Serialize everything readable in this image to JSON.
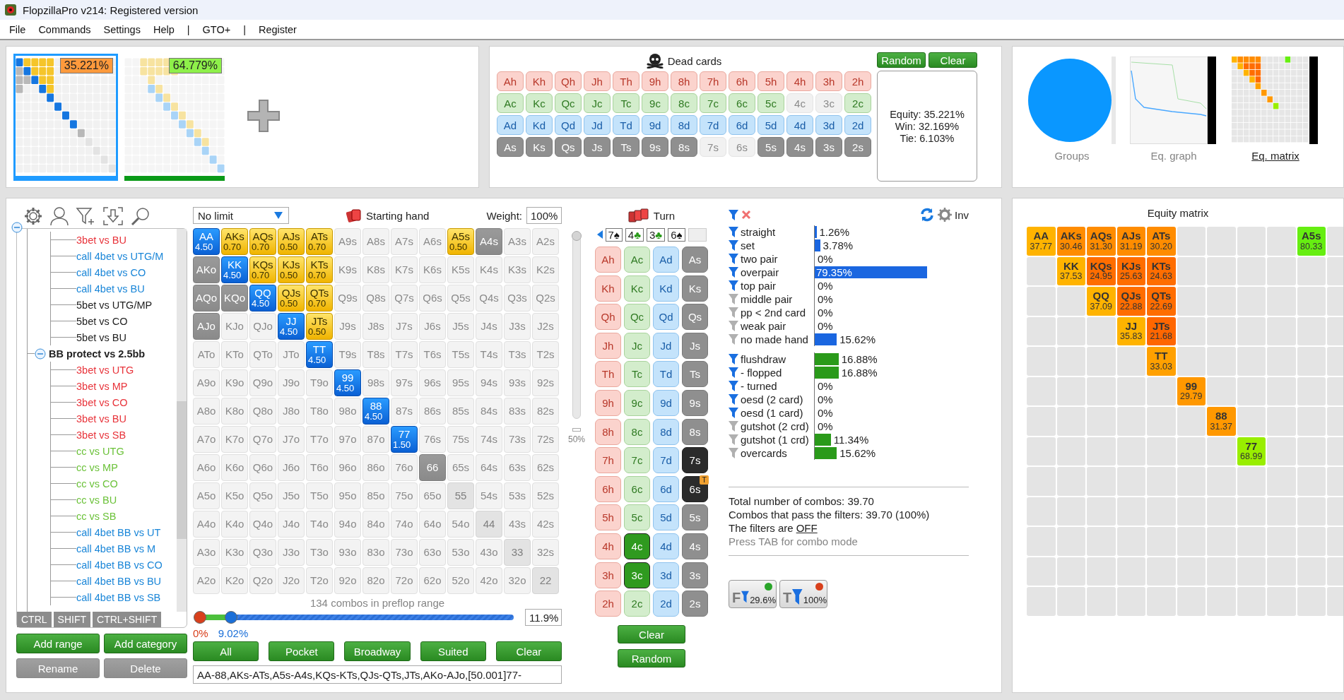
{
  "window": {
    "title": "FlopzillaPro v214: Registered version"
  },
  "menu": [
    "File",
    "Commands",
    "Settings",
    "Help",
    "|",
    "GTO+",
    "|",
    "Register"
  ],
  "ranges": [
    {
      "equity": "35.221%",
      "selected": true,
      "color": "#ff9a3c"
    },
    {
      "equity": "64.779%",
      "selected": false,
      "color": "#8ef04a"
    }
  ],
  "dead_cards": {
    "title": "Dead cards",
    "buttons": [
      "Random",
      "Clear"
    ],
    "rows": [
      {
        "kind": "hearts",
        "cards": [
          {
            "card": "Ah",
            "available": true
          },
          {
            "card": "Kh",
            "available": true
          },
          {
            "card": "Qh",
            "available": true
          },
          {
            "card": "Jh",
            "available": true
          },
          {
            "card": "Th",
            "available": true
          },
          {
            "card": "9h",
            "available": true
          },
          {
            "card": "8h",
            "available": true
          },
          {
            "card": "7h",
            "available": true
          },
          {
            "card": "6h",
            "available": true
          },
          {
            "card": "5h",
            "available": true
          },
          {
            "card": "4h",
            "available": true
          },
          {
            "card": "3h",
            "available": true
          },
          {
            "card": "2h",
            "available": true
          }
        ]
      },
      {
        "kind": "clubs",
        "cards": [
          {
            "card": "Ac",
            "available": true
          },
          {
            "card": "Kc",
            "available": true
          },
          {
            "card": "Qc",
            "available": true
          },
          {
            "card": "Jc",
            "available": true
          },
          {
            "card": "Tc",
            "available": true
          },
          {
            "card": "9c",
            "available": true
          },
          {
            "card": "8c",
            "available": true
          },
          {
            "card": "7c",
            "available": true
          },
          {
            "card": "6c",
            "available": true
          },
          {
            "card": "5c",
            "available": true
          },
          {
            "card": "4c",
            "available": false
          },
          {
            "card": "3c",
            "available": false
          },
          {
            "card": "2c",
            "available": true
          }
        ]
      },
      {
        "kind": "diamonds",
        "cards": [
          {
            "card": "Ad",
            "available": true
          },
          {
            "card": "Kd",
            "available": true
          },
          {
            "card": "Qd",
            "available": true
          },
          {
            "card": "Jd",
            "available": true
          },
          {
            "card": "Td",
            "available": true
          },
          {
            "card": "9d",
            "available": true
          },
          {
            "card": "8d",
            "available": true
          },
          {
            "card": "7d",
            "available": true
          },
          {
            "card": "6d",
            "available": true
          },
          {
            "card": "5d",
            "available": true
          },
          {
            "card": "4d",
            "available": true
          },
          {
            "card": "3d",
            "available": true
          },
          {
            "card": "2d",
            "available": true
          }
        ]
      },
      {
        "kind": "spades",
        "cards": [
          {
            "card": "As",
            "available": true
          },
          {
            "card": "Ks",
            "available": true
          },
          {
            "card": "Qs",
            "available": true
          },
          {
            "card": "Js",
            "available": true
          },
          {
            "card": "Ts",
            "available": true
          },
          {
            "card": "9s",
            "available": true
          },
          {
            "card": "8s",
            "available": true
          },
          {
            "card": "7s",
            "available": false
          },
          {
            "card": "6s",
            "available": false
          },
          {
            "card": "5s",
            "available": true
          },
          {
            "card": "4s",
            "available": true
          },
          {
            "card": "3s",
            "available": true
          },
          {
            "card": "2s",
            "available": true
          }
        ]
      }
    ],
    "results": [
      "Equity: 35.221%",
      "Win: 32.169%",
      "Tie: 6.103%"
    ]
  },
  "views": [
    {
      "label": "Groups",
      "kind": "pie",
      "selected": false
    },
    {
      "label": "Eq. graph",
      "kind": "graph",
      "selected": false
    },
    {
      "label": "Eq. matrix",
      "kind": "matrix",
      "selected": true
    }
  ],
  "tree": {
    "expanded": true,
    "groups": [
      {
        "children": [
          {
            "label": "3bet vs BU",
            "color": "#e8333a"
          },
          {
            "label": "call 4bet vs UTG/M",
            "color": "#1a86d8"
          },
          {
            "label": "call 4bet vs CO",
            "color": "#1a86d8"
          },
          {
            "label": "call 4bet vs BU",
            "color": "#1a86d8"
          },
          {
            "label": "5bet vs UTG/MP",
            "color": "#222222"
          },
          {
            "label": "5bet vs CO",
            "color": "#222222"
          },
          {
            "label": "5bet vs BU",
            "color": "#222222"
          }
        ]
      },
      {
        "label": "BB protect vs 2.5bb",
        "expanded": true,
        "children": [
          {
            "label": "3bet vs UTG",
            "color": "#e8333a"
          },
          {
            "label": "3bet vs MP",
            "color": "#e8333a"
          },
          {
            "label": "3bet vs CO",
            "color": "#e8333a"
          },
          {
            "label": "3bet vs BU",
            "color": "#e8333a"
          },
          {
            "label": "3bet vs SB",
            "color": "#e8333a"
          },
          {
            "label": "cc vs UTG",
            "color": "#6cc23a"
          },
          {
            "label": "cc vs MP",
            "color": "#6cc23a"
          },
          {
            "label": "cc vs CO",
            "color": "#6cc23a"
          },
          {
            "label": "cc vs BU",
            "color": "#6cc23a"
          },
          {
            "label": "cc vs SB",
            "color": "#6cc23a"
          },
          {
            "label": "call 4bet BB vs UT",
            "color": "#1a86d8"
          },
          {
            "label": "call 4bet BB vs M",
            "color": "#1a86d8"
          },
          {
            "label": "call 4bet BB vs CO",
            "color": "#1a86d8"
          },
          {
            "label": "call 4bet BB vs BU",
            "color": "#1a86d8"
          },
          {
            "label": "call 4bet BB vs SB",
            "color": "#1a86d8"
          }
        ]
      }
    ]
  },
  "modifier_keys": [
    "CTRL",
    "SHIFT",
    "CTRL+SHIFT"
  ],
  "tree_buttons": [
    {
      "label": "Add range",
      "disabled": false
    },
    {
      "label": "Add category",
      "disabled": false
    },
    {
      "label": "Rename",
      "disabled": true
    },
    {
      "label": "Delete",
      "disabled": true
    }
  ],
  "game": "No limit",
  "hand_title": "Starting hand",
  "weight_label": "Weight:",
  "weight": "100%",
  "weight_slider": {
    "level": 1,
    "tick": "50%"
  },
  "hand_matrix": [
    [
      {
        "hand": "AA",
        "kind": "pair",
        "weight": "4.50"
      },
      {
        "hand": "AKs",
        "kind": "suited",
        "weight": "0.70"
      },
      {
        "hand": "AQs",
        "kind": "suited",
        "weight": "0.70"
      },
      {
        "hand": "AJs",
        "kind": "suited",
        "weight": "0.50"
      },
      {
        "hand": "ATs",
        "kind": "suited",
        "weight": "0.70"
      },
      {
        "hand": "A9s",
        "kind": "none"
      },
      {
        "hand": "A8s",
        "kind": "none"
      },
      {
        "hand": "A7s",
        "kind": "none"
      },
      {
        "hand": "A6s",
        "kind": "none"
      },
      {
        "hand": "A5s",
        "kind": "suited",
        "weight": "0.50"
      },
      {
        "hand": "A4s",
        "kind": "partial"
      },
      {
        "hand": "A3s",
        "kind": "none"
      },
      {
        "hand": "A2s",
        "kind": "none"
      }
    ],
    [
      {
        "hand": "AKo",
        "kind": "partial"
      },
      {
        "hand": "KK",
        "kind": "pair",
        "weight": "4.50"
      },
      {
        "hand": "KQs",
        "kind": "suited",
        "weight": "0.70"
      },
      {
        "hand": "KJs",
        "kind": "suited",
        "weight": "0.50"
      },
      {
        "hand": "KTs",
        "kind": "suited",
        "weight": "0.70"
      },
      {
        "hand": "K9s",
        "kind": "none"
      },
      {
        "hand": "K8s",
        "kind": "none"
      },
      {
        "hand": "K7s",
        "kind": "none"
      },
      {
        "hand": "K6s",
        "kind": "none"
      },
      {
        "hand": "K5s",
        "kind": "none"
      },
      {
        "hand": "K4s",
        "kind": "none"
      },
      {
        "hand": "K3s",
        "kind": "none"
      },
      {
        "hand": "K2s",
        "kind": "none"
      }
    ],
    [
      {
        "hand": "AQo",
        "kind": "partial"
      },
      {
        "hand": "KQo",
        "kind": "partial"
      },
      {
        "hand": "QQ",
        "kind": "pair",
        "weight": "4.50"
      },
      {
        "hand": "QJs",
        "kind": "suited",
        "weight": "0.50"
      },
      {
        "hand": "QTs",
        "kind": "suited",
        "weight": "0.70"
      },
      {
        "hand": "Q9s",
        "kind": "none"
      },
      {
        "hand": "Q8s",
        "kind": "none"
      },
      {
        "hand": "Q7s",
        "kind": "none"
      },
      {
        "hand": "Q6s",
        "kind": "none"
      },
      {
        "hand": "Q5s",
        "kind": "none"
      },
      {
        "hand": "Q4s",
        "kind": "none"
      },
      {
        "hand": "Q3s",
        "kind": "none"
      },
      {
        "hand": "Q2s",
        "kind": "none"
      }
    ],
    [
      {
        "hand": "AJo",
        "kind": "partial"
      },
      {
        "hand": "KJo",
        "kind": "none"
      },
      {
        "hand": "QJo",
        "kind": "none"
      },
      {
        "hand": "JJ",
        "kind": "pair",
        "weight": "4.50"
      },
      {
        "hand": "JTs",
        "kind": "suited",
        "weight": "0.50"
      },
      {
        "hand": "J9s",
        "kind": "none"
      },
      {
        "hand": "J8s",
        "kind": "none"
      },
      {
        "hand": "J7s",
        "kind": "none"
      },
      {
        "hand": "J6s",
        "kind": "none"
      },
      {
        "hand": "J5s",
        "kind": "none"
      },
      {
        "hand": "J4s",
        "kind": "none"
      },
      {
        "hand": "J3s",
        "kind": "none"
      },
      {
        "hand": "J2s",
        "kind": "none"
      }
    ],
    [
      {
        "hand": "ATo",
        "kind": "none"
      },
      {
        "hand": "KTo",
        "kind": "none"
      },
      {
        "hand": "QTo",
        "kind": "none"
      },
      {
        "hand": "JTo",
        "kind": "none"
      },
      {
        "hand": "TT",
        "kind": "pair",
        "weight": "4.50"
      },
      {
        "hand": "T9s",
        "kind": "none"
      },
      {
        "hand": "T8s",
        "kind": "none"
      },
      {
        "hand": "T7s",
        "kind": "none"
      },
      {
        "hand": "T6s",
        "kind": "none"
      },
      {
        "hand": "T5s",
        "kind": "none"
      },
      {
        "hand": "T4s",
        "kind": "none"
      },
      {
        "hand": "T3s",
        "kind": "none"
      },
      {
        "hand": "T2s",
        "kind": "none"
      }
    ],
    [
      {
        "hand": "A9o",
        "kind": "none"
      },
      {
        "hand": "K9o",
        "kind": "none"
      },
      {
        "hand": "Q9o",
        "kind": "none"
      },
      {
        "hand": "J9o",
        "kind": "none"
      },
      {
        "hand": "T9o",
        "kind": "none"
      },
      {
        "hand": "99",
        "kind": "pair",
        "weight": "4.50"
      },
      {
        "hand": "98s",
        "kind": "none"
      },
      {
        "hand": "97s",
        "kind": "none"
      },
      {
        "hand": "96s",
        "kind": "none"
      },
      {
        "hand": "95s",
        "kind": "none"
      },
      {
        "hand": "94s",
        "kind": "none"
      },
      {
        "hand": "93s",
        "kind": "none"
      },
      {
        "hand": "92s",
        "kind": "none"
      }
    ],
    [
      {
        "hand": "A8o",
        "kind": "none"
      },
      {
        "hand": "K8o",
        "kind": "none"
      },
      {
        "hand": "Q8o",
        "kind": "none"
      },
      {
        "hand": "J8o",
        "kind": "none"
      },
      {
        "hand": "T8o",
        "kind": "none"
      },
      {
        "hand": "98o",
        "kind": "none"
      },
      {
        "hand": "88",
        "kind": "pair",
        "weight": "4.50"
      },
      {
        "hand": "87s",
        "kind": "none"
      },
      {
        "hand": "86s",
        "kind": "none"
      },
      {
        "hand": "85s",
        "kind": "none"
      },
      {
        "hand": "84s",
        "kind": "none"
      },
      {
        "hand": "83s",
        "kind": "none"
      },
      {
        "hand": "82s",
        "kind": "none"
      }
    ],
    [
      {
        "hand": "A7o",
        "kind": "none"
      },
      {
        "hand": "K7o",
        "kind": "none"
      },
      {
        "hand": "Q7o",
        "kind": "none"
      },
      {
        "hand": "J7o",
        "kind": "none"
      },
      {
        "hand": "T7o",
        "kind": "none"
      },
      {
        "hand": "97o",
        "kind": "none"
      },
      {
        "hand": "87o",
        "kind": "none"
      },
      {
        "hand": "77",
        "kind": "pair",
        "weight": "1.50"
      },
      {
        "hand": "76s",
        "kind": "none"
      },
      {
        "hand": "75s",
        "kind": "none"
      },
      {
        "hand": "74s",
        "kind": "none"
      },
      {
        "hand": "73s",
        "kind": "none"
      },
      {
        "hand": "72s",
        "kind": "none"
      }
    ],
    [
      {
        "hand": "A6o",
        "kind": "none"
      },
      {
        "hand": "K6o",
        "kind": "none"
      },
      {
        "hand": "Q6o",
        "kind": "none"
      },
      {
        "hand": "J6o",
        "kind": "none"
      },
      {
        "hand": "T6o",
        "kind": "none"
      },
      {
        "hand": "96o",
        "kind": "none"
      },
      {
        "hand": "86o",
        "kind": "none"
      },
      {
        "hand": "76o",
        "kind": "none"
      },
      {
        "hand": "66",
        "kind": "partial"
      },
      {
        "hand": "65s",
        "kind": "none"
      },
      {
        "hand": "64s",
        "kind": "none"
      },
      {
        "hand": "63s",
        "kind": "none"
      },
      {
        "hand": "62s",
        "kind": "none"
      }
    ],
    [
      {
        "hand": "A5o",
        "kind": "none"
      },
      {
        "hand": "K5o",
        "kind": "none"
      },
      {
        "hand": "Q5o",
        "kind": "none"
      },
      {
        "hand": "J5o",
        "kind": "none"
      },
      {
        "hand": "T5o",
        "kind": "none"
      },
      {
        "hand": "95o",
        "kind": "none"
      },
      {
        "hand": "85o",
        "kind": "none"
      },
      {
        "hand": "75o",
        "kind": "none"
      },
      {
        "hand": "65o",
        "kind": "none"
      },
      {
        "hand": "55",
        "kind": "dim"
      },
      {
        "hand": "54s",
        "kind": "none"
      },
      {
        "hand": "53s",
        "kind": "none"
      },
      {
        "hand": "52s",
        "kind": "none"
      }
    ],
    [
      {
        "hand": "A4o",
        "kind": "none"
      },
      {
        "hand": "K4o",
        "kind": "none"
      },
      {
        "hand": "Q4o",
        "kind": "none"
      },
      {
        "hand": "J4o",
        "kind": "none"
      },
      {
        "hand": "T4o",
        "kind": "none"
      },
      {
        "hand": "94o",
        "kind": "none"
      },
      {
        "hand": "84o",
        "kind": "none"
      },
      {
        "hand": "74o",
        "kind": "none"
      },
      {
        "hand": "64o",
        "kind": "none"
      },
      {
        "hand": "54o",
        "kind": "none"
      },
      {
        "hand": "44",
        "kind": "dim"
      },
      {
        "hand": "43s",
        "kind": "none"
      },
      {
        "hand": "42s",
        "kind": "none"
      }
    ],
    [
      {
        "hand": "A3o",
        "kind": "none"
      },
      {
        "hand": "K3o",
        "kind": "none"
      },
      {
        "hand": "Q3o",
        "kind": "none"
      },
      {
        "hand": "J3o",
        "kind": "none"
      },
      {
        "hand": "T3o",
        "kind": "none"
      },
      {
        "hand": "93o",
        "kind": "none"
      },
      {
        "hand": "83o",
        "kind": "none"
      },
      {
        "hand": "73o",
        "kind": "none"
      },
      {
        "hand": "63o",
        "kind": "none"
      },
      {
        "hand": "53o",
        "kind": "none"
      },
      {
        "hand": "43o",
        "kind": "none"
      },
      {
        "hand": "33",
        "kind": "dim"
      },
      {
        "hand": "32s",
        "kind": "none"
      }
    ],
    [
      {
        "hand": "A2o",
        "kind": "none"
      },
      {
        "hand": "K2o",
        "kind": "none"
      },
      {
        "hand": "Q2o",
        "kind": "none"
      },
      {
        "hand": "J2o",
        "kind": "none"
      },
      {
        "hand": "T2o",
        "kind": "none"
      },
      {
        "hand": "92o",
        "kind": "none"
      },
      {
        "hand": "82o",
        "kind": "none"
      },
      {
        "hand": "72o",
        "kind": "none"
      },
      {
        "hand": "62o",
        "kind": "none"
      },
      {
        "hand": "52o",
        "kind": "none"
      },
      {
        "hand": "42o",
        "kind": "none"
      },
      {
        "hand": "32o",
        "kind": "none"
      },
      {
        "hand": "22",
        "kind": "dim"
      }
    ]
  ],
  "combo_count": "134 combos in preflop range",
  "range_slider": {
    "thumbs": [
      {
        "level": 0,
        "label": "0%",
        "color": "#d8401c"
      },
      {
        "level": 0.1,
        "label": "9.02%",
        "color": "#1a6fd8"
      }
    ],
    "value": "11.9%"
  },
  "preset_buttons": [
    "All",
    "Pocket",
    "Broadway",
    "Suited",
    "Clear"
  ],
  "range_text": "AA-88,AKs-ATs,A5s-A4s,KQs-KTs,QJs-QTs,JTs,AKo-AJo,[50.001]77-",
  "turn": {
    "title": "Turn",
    "board": [
      {
        "rank": "7",
        "symbol": "♠",
        "kind": "spades"
      },
      {
        "rank": "4",
        "symbol": "♣",
        "kind": "clubs"
      },
      {
        "rank": "3",
        "symbol": "♣",
        "kind": "clubs"
      },
      {
        "rank": "6",
        "symbol": "♠",
        "kind": "spades"
      },
      {
        "kind": "empty"
      }
    ],
    "cards": [
      [
        {
          "card": "Ah",
          "kind": "hearts",
          "on_board": false
        },
        {
          "card": "Ac",
          "kind": "clubs",
          "on_board": false
        },
        {
          "card": "Ad",
          "kind": "diamonds",
          "on_board": false
        },
        {
          "card": "As",
          "kind": "spades",
          "on_board": false
        }
      ],
      [
        {
          "card": "Kh",
          "kind": "hearts",
          "on_board": false
        },
        {
          "card": "Kc",
          "kind": "clubs",
          "on_board": false
        },
        {
          "card": "Kd",
          "kind": "diamonds",
          "on_board": false
        },
        {
          "card": "Ks",
          "kind": "spades",
          "on_board": false
        }
      ],
      [
        {
          "card": "Qh",
          "kind": "hearts",
          "on_board": false
        },
        {
          "card": "Qc",
          "kind": "clubs",
          "on_board": false
        },
        {
          "card": "Qd",
          "kind": "diamonds",
          "on_board": false
        },
        {
          "card": "Qs",
          "kind": "spades",
          "on_board": false
        }
      ],
      [
        {
          "card": "Jh",
          "kind": "hearts",
          "on_board": false
        },
        {
          "card": "Jc",
          "kind": "clubs",
          "on_board": false
        },
        {
          "card": "Jd",
          "kind": "diamonds",
          "on_board": false
        },
        {
          "card": "Js",
          "kind": "spades",
          "on_board": false
        }
      ],
      [
        {
          "card": "Th",
          "kind": "hearts",
          "on_board": false
        },
        {
          "card": "Tc",
          "kind": "clubs",
          "on_board": false
        },
        {
          "card": "Td",
          "kind": "diamonds",
          "on_board": false
        },
        {
          "card": "Ts",
          "kind": "spades",
          "on_board": false
        }
      ],
      [
        {
          "card": "9h",
          "kind": "hearts",
          "on_board": false
        },
        {
          "card": "9c",
          "kind": "clubs",
          "on_board": false
        },
        {
          "card": "9d",
          "kind": "diamonds",
          "on_board": false
        },
        {
          "card": "9s",
          "kind": "spades",
          "on_board": false
        }
      ],
      [
        {
          "card": "8h",
          "kind": "hearts",
          "on_board": false
        },
        {
          "card": "8c",
          "kind": "clubs",
          "on_board": false
        },
        {
          "card": "8d",
          "kind": "diamonds",
          "on_board": false
        },
        {
          "card": "8s",
          "kind": "spades",
          "on_board": false
        }
      ],
      [
        {
          "card": "7h",
          "kind": "hearts",
          "on_board": false
        },
        {
          "card": "7c",
          "kind": "clubs",
          "on_board": false
        },
        {
          "card": "7d",
          "kind": "diamonds",
          "on_board": false
        },
        {
          "card": "7s",
          "kind": "spades",
          "on_board": true
        }
      ],
      [
        {
          "card": "6h",
          "kind": "hearts",
          "on_board": false
        },
        {
          "card": "6c",
          "kind": "clubs",
          "on_board": false
        },
        {
          "card": "6d",
          "kind": "diamonds",
          "on_board": false
        },
        {
          "card": "6s",
          "kind": "spades",
          "on_board": true,
          "badge": "T"
        }
      ],
      [
        {
          "card": "5h",
          "kind": "hearts",
          "on_board": false
        },
        {
          "card": "5c",
          "kind": "clubs",
          "on_board": false
        },
        {
          "card": "5d",
          "kind": "diamonds",
          "on_board": false
        },
        {
          "card": "5s",
          "kind": "spades",
          "on_board": false
        }
      ],
      [
        {
          "card": "4h",
          "kind": "hearts",
          "on_board": false
        },
        {
          "card": "4c",
          "kind": "clubs",
          "on_board": true
        },
        {
          "card": "4d",
          "kind": "diamonds",
          "on_board": false
        },
        {
          "card": "4s",
          "kind": "spades",
          "on_board": false
        }
      ],
      [
        {
          "card": "3h",
          "kind": "hearts",
          "on_board": false
        },
        {
          "card": "3c",
          "kind": "clubs",
          "on_board": true
        },
        {
          "card": "3d",
          "kind": "diamonds",
          "on_board": false
        },
        {
          "card": "3s",
          "kind": "spades",
          "on_board": false
        }
      ],
      [
        {
          "card": "2h",
          "kind": "hearts",
          "on_board": false
        },
        {
          "card": "2c",
          "kind": "clubs",
          "on_board": false
        },
        {
          "card": "2d",
          "kind": "diamonds",
          "on_board": false
        },
        {
          "card": "2s",
          "kind": "spades",
          "on_board": false
        }
      ]
    ],
    "buttons": [
      "Clear",
      "Random"
    ]
  },
  "filter_header": {
    "inv": "Inv"
  },
  "filters": [
    {
      "color": "#1a66e0",
      "rows": [
        {
          "label": "straight",
          "value": "1.26%",
          "level": 0.0126,
          "active": true
        },
        {
          "label": "set",
          "value": "3.78%",
          "level": 0.0378,
          "active": true
        },
        {
          "label": "two pair",
          "value": "0%",
          "active": true
        },
        {
          "label": "overpair",
          "value": "79.35%",
          "level": 0.7935,
          "active": true
        },
        {
          "label": "top pair",
          "value": "0%",
          "active": true
        },
        {
          "label": "middle pair",
          "value": "0%",
          "active": false
        },
        {
          "label": "pp < 2nd card",
          "value": "0%",
          "active": false
        },
        {
          "label": "weak pair",
          "value": "0%",
          "active": false
        },
        {
          "label": "no made hand",
          "value": "15.62%",
          "level": 0.1562,
          "active": false
        }
      ]
    },
    {
      "color": "#2a9a1a",
      "rows": [
        {
          "label": "flushdraw",
          "value": "16.88%",
          "level": 0.1688,
          "active": true
        },
        {
          "label": "- flopped",
          "value": "16.88%",
          "level": 0.1688,
          "active": true
        },
        {
          "label": "- turned",
          "value": "0%",
          "active": true
        },
        {
          "label": "oesd (2 card)",
          "value": "0%",
          "active": true
        },
        {
          "label": "oesd (1 card)",
          "value": "0%",
          "active": true
        },
        {
          "label": "gutshot (2 crd)",
          "value": "0%",
          "active": false
        },
        {
          "label": "gutshot (1 crd)",
          "value": "11.34%",
          "level": 0.1134,
          "active": false
        },
        {
          "label": "overcards",
          "value": "15.62%",
          "level": 0.1562,
          "active": false
        }
      ]
    }
  ],
  "summary": {
    "total": "Total number of combos: 39.70",
    "passing": "Combos that pass the filters: 39.70 (100%)",
    "state_label": "The filters are",
    "state": "OFF",
    "hint": "Press TAB for combo mode"
  },
  "toggles": [
    {
      "letter": "F",
      "value": "29.6%",
      "on": true
    },
    {
      "letter": "T",
      "value": "100%",
      "on": false
    }
  ],
  "equity_matrix": {
    "title": "Equity matrix",
    "rows": [
      [
        {
          "kind": "hand",
          "hand": "AA",
          "equity": "37.77",
          "color": "#ffb300"
        },
        {
          "kind": "hand",
          "hand": "AKs",
          "equity": "30.46",
          "color": "#ff8c00"
        },
        {
          "kind": "hand",
          "hand": "AQs",
          "equity": "31.30",
          "color": "#ff8c00"
        },
        {
          "kind": "hand",
          "hand": "AJs",
          "equity": "31.19",
          "color": "#ff8c00"
        },
        {
          "kind": "hand",
          "hand": "ATs",
          "equity": "30.20",
          "color": "#ff8c00"
        },
        {
          "kind": "empty"
        },
        {
          "kind": "empty"
        },
        {
          "kind": "empty"
        },
        {
          "kind": "empty"
        },
        {
          "kind": "hand",
          "hand": "A5s",
          "equity": "80.33",
          "color": "#66ee11"
        }
      ],
      [
        {
          "kind": "empty"
        },
        {
          "kind": "hand",
          "hand": "KK",
          "equity": "37.53",
          "color": "#ffb300"
        },
        {
          "kind": "hand",
          "hand": "KQs",
          "equity": "24.95",
          "color": "#ff6d00"
        },
        {
          "kind": "hand",
          "hand": "KJs",
          "equity": "25.63",
          "color": "#ff6d00"
        },
        {
          "kind": "hand",
          "hand": "KTs",
          "equity": "24.63",
          "color": "#ff6d00"
        }
      ],
      [
        {
          "kind": "empty"
        },
        {
          "kind": "empty"
        },
        {
          "kind": "hand",
          "hand": "QQ",
          "equity": "37.09",
          "color": "#ffb300"
        },
        {
          "kind": "hand",
          "hand": "QJs",
          "equity": "22.88",
          "color": "#ff6d00"
        },
        {
          "kind": "hand",
          "hand": "QTs",
          "equity": "22.69",
          "color": "#ff6d00"
        }
      ],
      [
        {
          "kind": "empty"
        },
        {
          "kind": "empty"
        },
        {
          "kind": "empty"
        },
        {
          "kind": "hand",
          "hand": "JJ",
          "equity": "35.83",
          "color": "#ffb300"
        },
        {
          "kind": "hand",
          "hand": "JTs",
          "equity": "21.68",
          "color": "#ff6600"
        }
      ],
      [
        {
          "kind": "empty"
        },
        {
          "kind": "empty"
        },
        {
          "kind": "empty"
        },
        {
          "kind": "empty"
        },
        {
          "kind": "hand",
          "hand": "TT",
          "equity": "33.03",
          "color": "#ffa000"
        }
      ],
      [
        {
          "kind": "empty"
        },
        {
          "kind": "empty"
        },
        {
          "kind": "empty"
        },
        {
          "kind": "empty"
        },
        {
          "kind": "empty"
        },
        {
          "kind": "hand",
          "hand": "99",
          "equity": "29.79",
          "color": "#ff9800"
        }
      ],
      [
        {
          "kind": "empty"
        },
        {
          "kind": "empty"
        },
        {
          "kind": "empty"
        },
        {
          "kind": "empty"
        },
        {
          "kind": "empty"
        },
        {
          "kind": "empty"
        },
        {
          "kind": "hand",
          "hand": "88",
          "equity": "31.37",
          "color": "#ff9800"
        }
      ],
      [
        {
          "kind": "empty"
        },
        {
          "kind": "empty"
        },
        {
          "kind": "empty"
        },
        {
          "kind": "empty"
        },
        {
          "kind": "empty"
        },
        {
          "kind": "empty"
        },
        {
          "kind": "empty"
        },
        {
          "kind": "hand",
          "hand": "77",
          "equity": "68.99",
          "color": "#99ee00"
        }
      ]
    ]
  }
}
